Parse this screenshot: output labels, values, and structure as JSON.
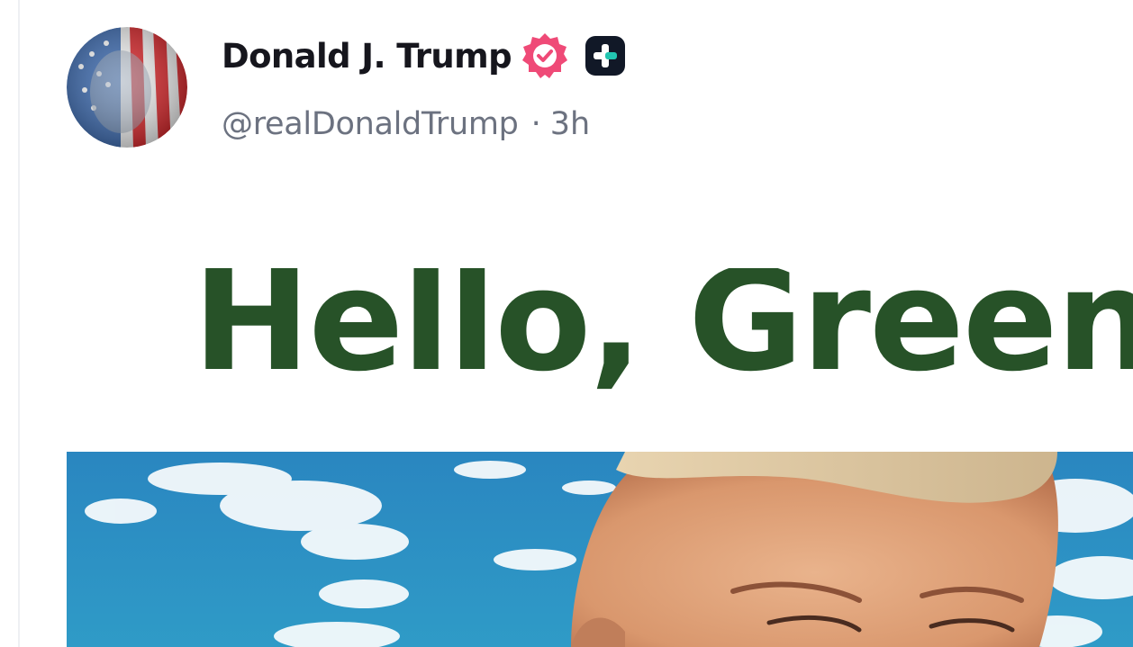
{
  "post": {
    "author": {
      "display_name": "Donald J. Trump",
      "handle": "@realDonaldTrump",
      "verified_icon": "verified-badge-icon",
      "extra_badge_icon": "plus-badge-icon",
      "avatar_icon": "avatar-image"
    },
    "separator": "·",
    "timestamp": "3h",
    "media": {
      "headline": "Hello, Greenl",
      "image_icon": "portrait-photo"
    }
  },
  "colors": {
    "name": "#16161d",
    "meta": "#6c7280",
    "verified": "#ef4a77",
    "badge_dark": "#111827",
    "badge_accent": "#22c5b1",
    "headline": "#275228",
    "sky": "#2b8fc4"
  }
}
